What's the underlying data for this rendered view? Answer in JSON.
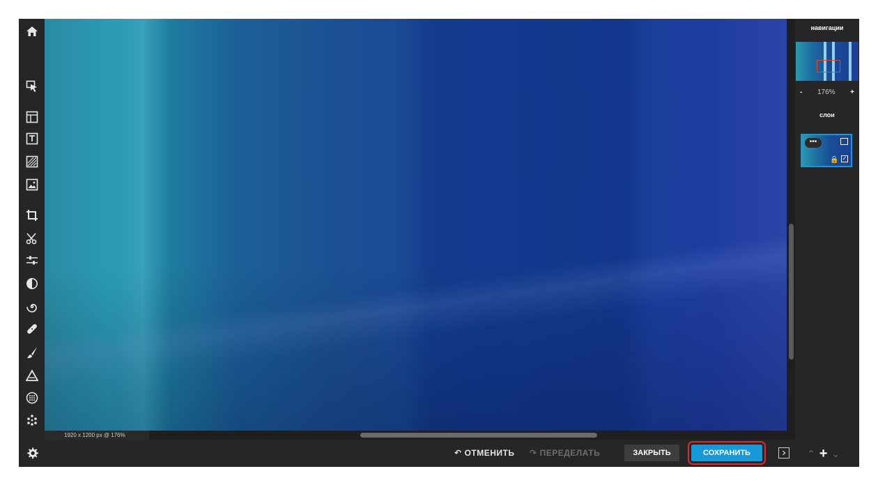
{
  "app": {
    "name": "photo-editor"
  },
  "toolbar": {
    "tools": [
      "home-icon",
      "select-icon",
      "frame-icon",
      "text-icon",
      "texture-icon",
      "image-icon",
      "crop-icon",
      "cut-icon",
      "adjust-icon",
      "contrast-icon",
      "spiral-icon",
      "healing-icon",
      "brush-icon",
      "shape-icon",
      "sphere-icon",
      "effects-icon"
    ],
    "settings_icon": "gear-icon"
  },
  "canvas": {
    "info": "1920 x 1200 px @ 176%"
  },
  "bottom_bar": {
    "undo_label": "ОТМЕНИТЬ",
    "redo_label": "ПЕРЕДЕЛАТЬ",
    "close_label": "ЗАКРЫТЬ",
    "save_label": "СОХРАНИТЬ",
    "save_color": "#1798d8",
    "highlight_color": "#e02b2b"
  },
  "right_panel": {
    "navigation_title": "навигации",
    "zoom_minus": "-",
    "zoom_value": "176%",
    "zoom_plus": "+",
    "layers_title": "слои",
    "layer_menu": "•••"
  }
}
